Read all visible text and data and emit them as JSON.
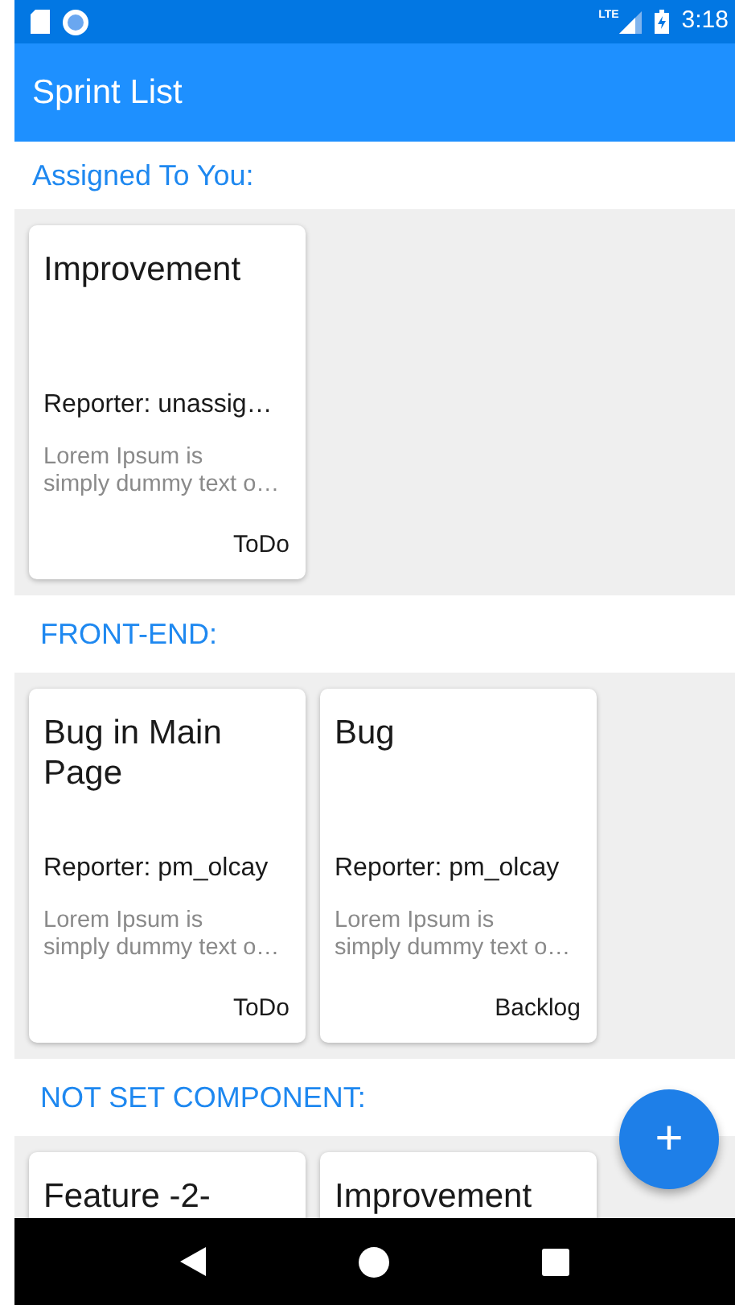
{
  "status_bar": {
    "network": "LTE",
    "time": "3:18"
  },
  "app_bar": {
    "title": "Sprint List"
  },
  "sections": [
    {
      "title": "Assigned To You:",
      "cards": [
        {
          "title": "Improvement",
          "reporter": "Reporter: unassig…",
          "description": [
            "Lorem Ipsum is",
            "simply dummy text o…"
          ],
          "status": "ToDo"
        }
      ]
    },
    {
      "title": "FRONT-END:",
      "cards": [
        {
          "title": "Bug in Main Page",
          "reporter": "Reporter: pm_olcay",
          "description": [
            "Lorem Ipsum is",
            "simply dummy text o…"
          ],
          "status": "ToDo"
        },
        {
          "title": "Bug",
          "reporter": "Reporter: pm_olcay",
          "description": [
            "Lorem Ipsum is",
            "simply dummy text o…"
          ],
          "status": "Backlog"
        }
      ]
    },
    {
      "title": "NOT SET COMPONENT:",
      "cards": [
        {
          "title": "Feature -2-"
        },
        {
          "title": "Improvement"
        }
      ]
    }
  ],
  "fab": {
    "label": "+"
  }
}
